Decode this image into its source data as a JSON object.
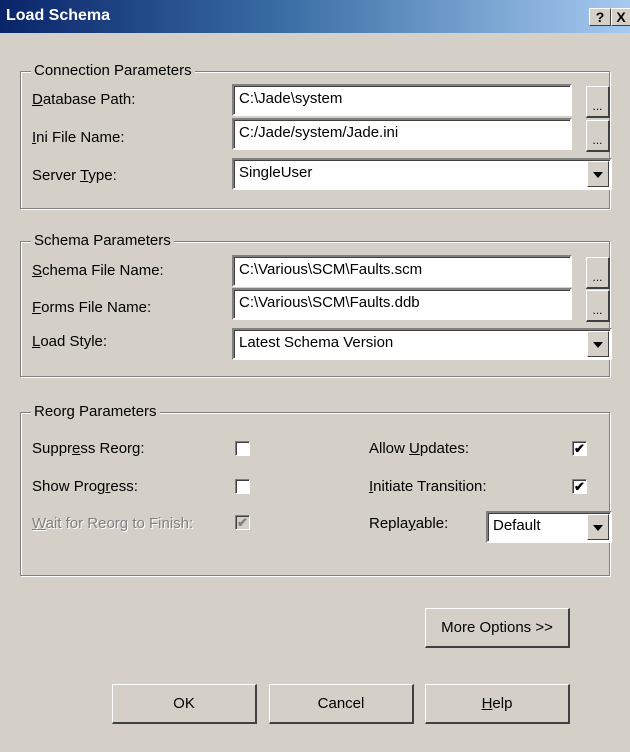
{
  "window": {
    "title": "Load Schema",
    "help_glyph": "?",
    "close_glyph": "X"
  },
  "connection": {
    "legend": "Connection Parameters",
    "db_path_label_pre": "",
    "db_path_label_key": "D",
    "db_path_label_post": "atabase Path:",
    "db_path_value": "C:\\Jade\\system",
    "ini_label_pre": "",
    "ini_label_key": "I",
    "ini_label_post": "ni File Name:",
    "ini_value": "C:/Jade/system/Jade.ini",
    "server_label_pre": "Server ",
    "server_label_key": "T",
    "server_label_post": "ype:",
    "server_value": "SingleUser",
    "browse_label": "..."
  },
  "schema": {
    "legend": "Schema Parameters",
    "schema_label_pre": "",
    "schema_label_key": "S",
    "schema_label_post": "chema File Name:",
    "schema_value": "C:\\Various\\SCM\\Faults.scm",
    "forms_label_pre": "",
    "forms_label_key": "F",
    "forms_label_post": "orms File Name:",
    "forms_value": "C:\\Various\\SCM\\Faults.ddb",
    "style_label_pre": "",
    "style_label_key": "L",
    "style_label_post": "oad Style:",
    "style_value": "Latest Schema Version"
  },
  "reorg": {
    "legend": "Reorg Parameters",
    "suppress_pre": "Suppr",
    "suppress_key": "e",
    "suppress_post": "ss Reorg:",
    "suppress_checked": false,
    "progress_pre": "Show Prog",
    "progress_key": "r",
    "progress_post": "ess:",
    "progress_checked": false,
    "wait_pre": "",
    "wait_key": "W",
    "wait_post": "ait for Reorg to Finish:",
    "wait_checked": true,
    "allow_pre": "Allow ",
    "allow_key": "U",
    "allow_post": "pdates:",
    "allow_checked": true,
    "initiate_pre": "",
    "initiate_key": "I",
    "initiate_post": "nitiate Transition:",
    "initiate_checked": true,
    "replay_pre": "Repla",
    "replay_key": "y",
    "replay_post": "able:",
    "replay_value": "Default"
  },
  "buttons": {
    "more_options": "More Options >>",
    "ok": "OK",
    "cancel": "Cancel",
    "help_pre": "",
    "help_key": "H",
    "help_post": "elp"
  },
  "check_glyph": "✔"
}
